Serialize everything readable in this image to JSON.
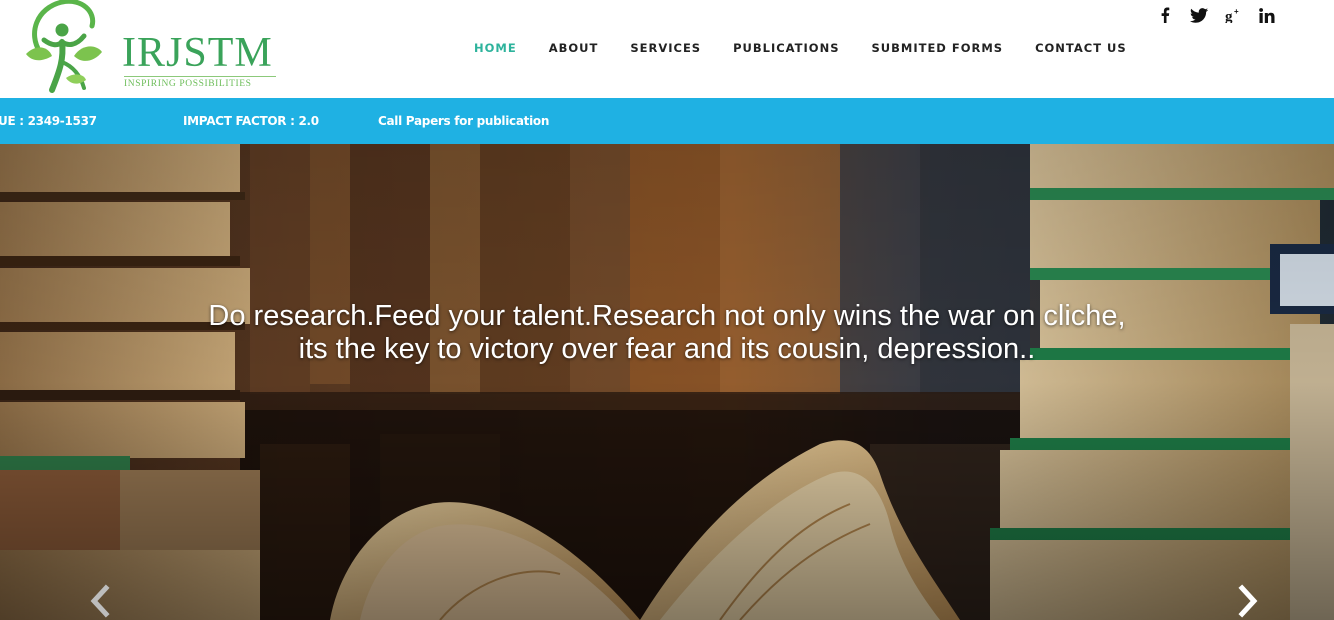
{
  "brand": {
    "name": "IRJSTM",
    "tagline": "INSPIRING POSSIBILITIES",
    "color": "#3aa35a"
  },
  "nav": {
    "items": [
      {
        "label": "HOME",
        "active": true
      },
      {
        "label": "ABOUT",
        "active": false
      },
      {
        "label": "SERVICES",
        "active": false
      },
      {
        "label": "PUBLICATIONS",
        "active": false
      },
      {
        "label": "SUBMITED FORMS",
        "active": false
      },
      {
        "label": "CONTACT US",
        "active": false
      }
    ],
    "active_color": "#2db39c"
  },
  "social": {
    "icons": [
      "facebook-icon",
      "twitter-icon",
      "google-plus-icon",
      "linkedin-icon"
    ]
  },
  "info_bar": {
    "issn": "UE : 2349-1537",
    "impact_factor": "IMPACT FACTOR : 2.0",
    "call_papers": "Call Papers for publication",
    "color": "#1fb1e3"
  },
  "hero": {
    "caption_line1": "Do research.Feed your talent.Research not only wins the war on cliche,",
    "caption_line2": "its the key to victory over fear and its cousin, depression..",
    "prev_icon": "chevron-left-icon",
    "next_icon": "chevron-right-icon"
  }
}
